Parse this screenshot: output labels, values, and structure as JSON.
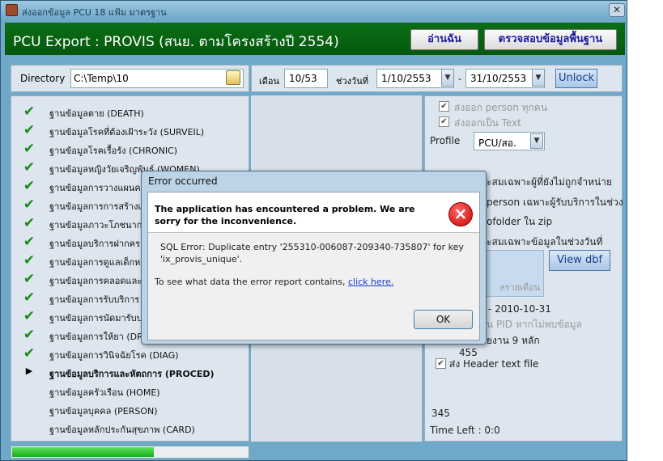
{
  "window": {
    "title": "ส่งออกข้อมูล PCU 18 แฟ้ม มาตรฐาน",
    "close_glyph": "✕"
  },
  "header": {
    "title": "PCU Export : PROVIS (สนย. ตามโครงสร้างปี 2554)",
    "read_button": "อ่านฉัน",
    "check_button": "ตรวจสอบข้อมูลพื้นฐาน"
  },
  "directory": {
    "label": "Directory",
    "value": "C:\\Temp\\10"
  },
  "dates": {
    "month_label": "เดือน",
    "month_value": "10/53",
    "range_label": "ช่วงวันที่",
    "from": "1/10/2553",
    "dash": "-",
    "to": "31/10/2553",
    "unlock": "Unlock"
  },
  "files": [
    {
      "label": "ฐานข้อมูลตาย (DEATH)",
      "status": "done"
    },
    {
      "label": "ฐานข้อมูลโรคที่ต้องเฝ้าระวัง (SURVEIL)",
      "status": "done"
    },
    {
      "label": "ฐานข้อมูลโรคเรื้อรัง (CHRONIC)",
      "status": "done"
    },
    {
      "label": "ฐานข้อมูลหญิงวัยเจริญพันธุ์ (WOMEN)",
      "status": "done"
    },
    {
      "label": "ฐานข้อมูลการวางแผนครอ",
      "status": "done"
    },
    {
      "label": "ฐานข้อมูลการการสร้างเส",
      "status": "done"
    },
    {
      "label": "ฐานข้อมูลภาวะโภชนาการ",
      "status": "done"
    },
    {
      "label": "ฐานข้อมูลบริการฝากครรภ์",
      "status": "done"
    },
    {
      "label": "ฐานข้อมูลการดูแลเด็กหลั",
      "status": "done"
    },
    {
      "label": "ฐานข้อมูลการคลอดและดู",
      "status": "done"
    },
    {
      "label": "ฐานข้อมูลการรับบริการ",
      "status": "done"
    },
    {
      "label": "ฐานข้อมูลการนัดมารับบริ",
      "status": "done"
    },
    {
      "label": "ฐานข้อมูลการให้ยา (DRU",
      "status": "done"
    },
    {
      "label": "ฐานข้อมูลการวินิจฉัยโรค (DIAG)",
      "status": "done"
    },
    {
      "label": "ฐานข้อมูลบริการและหัตถการ (PROCED)",
      "status": "current"
    },
    {
      "label": "ฐานข้อมูลครัวเรือน (HOME)",
      "status": "pending"
    },
    {
      "label": "ฐานข้อมูลบุคคล (PERSON)",
      "status": "pending"
    },
    {
      "label": "ฐานข้อมูลหลักประกันสุขภาพ (CARD)",
      "status": "pending"
    }
  ],
  "options": {
    "export_person_all": "ส่งออก person ทุกคน",
    "export_text": "ส่งออกเป็น Text",
    "profile_label": "Profile",
    "profile_value": "PCU/สอ.",
    "opt1_partial": "ะสมเฉพาะผู้ที่ยังไม่ถูกจำหน่าย",
    "opt2_partial": "person เฉพาะผู้รับบริการในช่วง",
    "opt3_partial": "ofolder ใน zip",
    "opt4_partial": "ะสมเฉพาะข้อมูลในช่วงวันที่",
    "bigbtn_partial": "ลรายเดือน",
    "view_dbf": "View dbf",
    "date_partial": "- 2010-10-31",
    "pid_partial": "น PID หากไม่พบข้อมูล",
    "code_partial": "ยงาน 9 หลัก",
    "count_partial": "455",
    "header_text_file": "ส่ง Header text file",
    "record_count": "345",
    "time_left": "Time Left : 0:0"
  },
  "progress": {
    "value": 0.6
  },
  "dialog": {
    "title": "Error occurred",
    "heading": "The application has encountered a problem. We are sorry for the inconvenience.",
    "message": "SQL Error: Duplicate entry '255310-006087-209340-735807' for key 'ix_provis_unique'.",
    "report_text": "To see what data the error report contains, ",
    "link_text": "click here.",
    "ok": "OK",
    "icon": "×"
  },
  "colors": {
    "header_green": "#0a6e16",
    "check_green": "#1a8a1a",
    "window_blue": "#6fa8c8",
    "error_red": "#c80000"
  }
}
